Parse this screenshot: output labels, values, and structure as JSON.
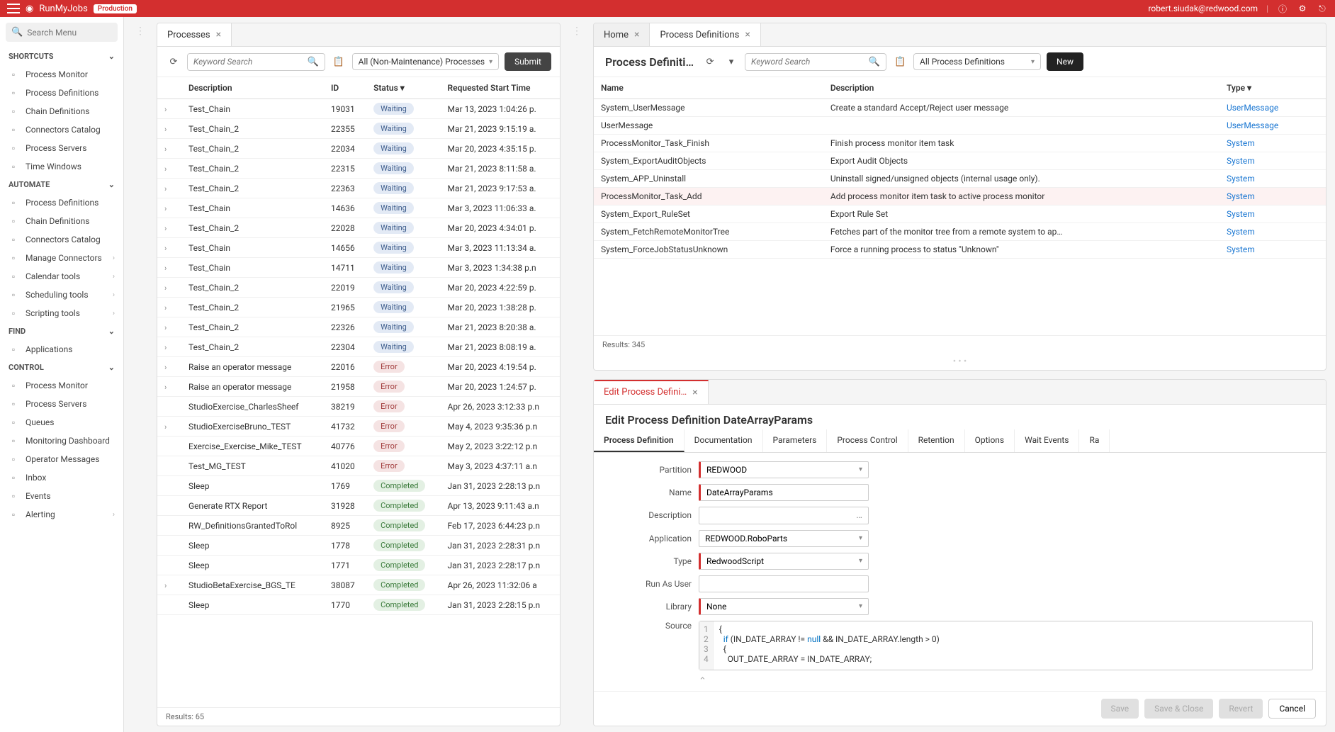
{
  "topbar": {
    "app_name": "RunMyJobs",
    "badge": "Production",
    "user": "robert.siudak@redwood.com"
  },
  "sidebar": {
    "search_placeholder": "Search Menu",
    "sections": [
      {
        "title": "SHORTCUTS",
        "items": [
          {
            "label": "Process Monitor"
          },
          {
            "label": "Process Definitions"
          },
          {
            "label": "Chain Definitions"
          },
          {
            "label": "Connectors Catalog"
          },
          {
            "label": "Process Servers"
          },
          {
            "label": "Time Windows"
          }
        ]
      },
      {
        "title": "AUTOMATE",
        "items": [
          {
            "label": "Process Definitions"
          },
          {
            "label": "Chain Definitions"
          },
          {
            "label": "Connectors Catalog"
          },
          {
            "label": "Manage Connectors",
            "chevron": true
          },
          {
            "label": "Calendar tools",
            "chevron": true
          },
          {
            "label": "Scheduling tools",
            "chevron": true
          },
          {
            "label": "Scripting tools",
            "chevron": true
          }
        ]
      },
      {
        "title": "FIND",
        "items": [
          {
            "label": "Applications"
          }
        ]
      },
      {
        "title": "CONTROL",
        "items": [
          {
            "label": "Process Monitor"
          },
          {
            "label": "Process Servers"
          },
          {
            "label": "Queues"
          },
          {
            "label": "Monitoring Dashboard"
          },
          {
            "label": "Operator Messages"
          },
          {
            "label": "Inbox"
          },
          {
            "label": "Events"
          },
          {
            "label": "Alerting",
            "chevron": true
          }
        ]
      }
    ]
  },
  "processes": {
    "tab_label": "Processes",
    "search_placeholder": "Keyword Search",
    "filter": "All (Non-Maintenance) Processes",
    "submit": "Submit",
    "columns": [
      "Description",
      "ID",
      "Status",
      "Requested Start Time"
    ],
    "rows": [
      {
        "expand": true,
        "desc": "Test_Chain",
        "id": "19031",
        "status": "Waiting",
        "time": "Mar 13, 2023 1:04:26 p."
      },
      {
        "expand": true,
        "desc": "Test_Chain_2",
        "id": "22355",
        "status": "Waiting",
        "time": "Mar 21, 2023 9:15:19 a."
      },
      {
        "expand": true,
        "desc": "Test_Chain_2",
        "id": "22034",
        "status": "Waiting",
        "time": "Mar 20, 2023 4:35:15 p."
      },
      {
        "expand": true,
        "desc": "Test_Chain_2",
        "id": "22315",
        "status": "Waiting",
        "time": "Mar 21, 2023 8:11:58 a."
      },
      {
        "expand": true,
        "desc": "Test_Chain_2",
        "id": "22363",
        "status": "Waiting",
        "time": "Mar 21, 2023 9:17:53 a."
      },
      {
        "expand": true,
        "desc": "Test_Chain",
        "id": "14636",
        "status": "Waiting",
        "time": "Mar 3, 2023 11:06:33 a."
      },
      {
        "expand": true,
        "desc": "Test_Chain_2",
        "id": "22028",
        "status": "Waiting",
        "time": "Mar 20, 2023 4:34:01 p."
      },
      {
        "expand": true,
        "desc": "Test_Chain",
        "id": "14656",
        "status": "Waiting",
        "time": "Mar 3, 2023 11:13:34 a."
      },
      {
        "expand": true,
        "desc": "Test_Chain",
        "id": "14711",
        "status": "Waiting",
        "time": "Mar 3, 2023 1:34:38 p.n"
      },
      {
        "expand": true,
        "desc": "Test_Chain_2",
        "id": "22019",
        "status": "Waiting",
        "time": "Mar 20, 2023 4:22:59 p."
      },
      {
        "expand": true,
        "desc": "Test_Chain_2",
        "id": "21965",
        "status": "Waiting",
        "time": "Mar 20, 2023 1:38:28 p."
      },
      {
        "expand": true,
        "desc": "Test_Chain_2",
        "id": "22326",
        "status": "Waiting",
        "time": "Mar 21, 2023 8:20:38 a."
      },
      {
        "expand": true,
        "desc": "Test_Chain_2",
        "id": "22304",
        "status": "Waiting",
        "time": "Mar 21, 2023 8:08:19 a."
      },
      {
        "expand": true,
        "desc": "Raise an operator message",
        "id": "22016",
        "status": "Error",
        "time": "Mar 20, 2023 4:19:54 p."
      },
      {
        "expand": true,
        "desc": "Raise an operator message",
        "id": "21958",
        "status": "Error",
        "time": "Mar 20, 2023 1:24:57 p."
      },
      {
        "expand": false,
        "desc": "StudioExercise_CharlesSheef",
        "id": "38219",
        "status": "Error",
        "time": "Apr 26, 2023 3:12:33 p.n"
      },
      {
        "expand": true,
        "desc": "StudioExerciseBruno_TEST",
        "id": "41732",
        "status": "Error",
        "time": "May 4, 2023 9:35:36 p.n"
      },
      {
        "expand": false,
        "desc": "Exercise_Exercise_Mike_TEST",
        "id": "40776",
        "status": "Error",
        "time": "May 2, 2023 3:22:12 p.n"
      },
      {
        "expand": false,
        "desc": "Test_MG_TEST",
        "id": "41020",
        "status": "Error",
        "time": "May 3, 2023 4:37:11 a.n"
      },
      {
        "expand": false,
        "desc": "Sleep",
        "id": "1769",
        "status": "Completed",
        "time": "Jan 31, 2023 2:28:13 p.n"
      },
      {
        "expand": false,
        "desc": "Generate RTX Report",
        "id": "31928",
        "status": "Completed",
        "time": "Apr 13, 2023 9:11:43 a.n"
      },
      {
        "expand": false,
        "desc": "RW_DefinitionsGrantedToRol",
        "id": "8925",
        "status": "Completed",
        "time": "Feb 17, 2023 6:44:23 p.n"
      },
      {
        "expand": false,
        "desc": "Sleep",
        "id": "1778",
        "status": "Completed",
        "time": "Jan 31, 2023 2:28:31 p.n"
      },
      {
        "expand": false,
        "desc": "Sleep",
        "id": "1771",
        "status": "Completed",
        "time": "Jan 31, 2023 2:28:17 p.n"
      },
      {
        "expand": true,
        "desc": "StudioBetaExercise_BGS_TE",
        "id": "38087",
        "status": "Completed",
        "time": "Apr 26, 2023 11:32:06 a"
      },
      {
        "expand": false,
        "desc": "Sleep",
        "id": "1770",
        "status": "Completed",
        "time": "Jan 31, 2023 2:28:15 p.n"
      }
    ],
    "results": "Results: 65"
  },
  "definitions": {
    "home_tab": "Home",
    "tab_label": "Process Definitions",
    "title": "Process Definiti…",
    "search_placeholder": "Keyword Search",
    "filter": "All Process Definitions",
    "new_btn": "New",
    "columns": [
      "Name",
      "Description",
      "Type"
    ],
    "rows": [
      {
        "name": "System_UserMessage",
        "desc": "Create a standard Accept/Reject user message",
        "type": "UserMessage"
      },
      {
        "name": "UserMessage",
        "desc": "",
        "type": "UserMessage"
      },
      {
        "name": "ProcessMonitor_Task_Finish",
        "desc": "Finish process monitor item task",
        "type": "System"
      },
      {
        "name": "System_ExportAuditObjects",
        "desc": "Export Audit Objects",
        "type": "System"
      },
      {
        "name": "System_APP_Uninstall",
        "desc": "Uninstall signed/unsigned objects (internal usage only).",
        "type": "System"
      },
      {
        "name": "ProcessMonitor_Task_Add",
        "desc": "Add process monitor item task to active process monitor",
        "type": "System",
        "highlight": true
      },
      {
        "name": "System_Export_RuleSet",
        "desc": "Export Rule Set",
        "type": "System"
      },
      {
        "name": "System_FetchRemoteMonitorTree",
        "desc": "Fetches part of the monitor tree from a remote system to ap…",
        "type": "System"
      },
      {
        "name": "System_ForceJobStatusUnknown",
        "desc": "Force a running process to status \"Unknown\"",
        "type": "System"
      }
    ],
    "results": "Results: 345"
  },
  "edit_panel": {
    "tab_label": "Edit Process Defini…",
    "title": "Edit Process Definition DateArrayParams",
    "tabs": [
      "Process Definition",
      "Documentation",
      "Parameters",
      "Process Control",
      "Retention",
      "Options",
      "Wait Events",
      "Ra"
    ],
    "fields": {
      "partition_label": "Partition",
      "partition_value": "REDWOOD",
      "name_label": "Name",
      "name_value": "DateArrayParams",
      "description_label": "Description",
      "description_value": "",
      "application_label": "Application",
      "application_value": "REDWOOD.RoboParts",
      "type_label": "Type",
      "type_value": "RedwoodScript",
      "runas_label": "Run As User",
      "runas_value": "",
      "library_label": "Library",
      "library_value": "None",
      "source_label": "Source"
    },
    "code_lines": [
      "{",
      "  if (IN_DATE_ARRAY != null && IN_DATE_ARRAY.length > 0)",
      "  {",
      "    OUT_DATE_ARRAY = IN_DATE_ARRAY;"
    ],
    "buttons": {
      "save": "Save",
      "save_close": "Save & Close",
      "revert": "Revert",
      "cancel": "Cancel"
    }
  }
}
